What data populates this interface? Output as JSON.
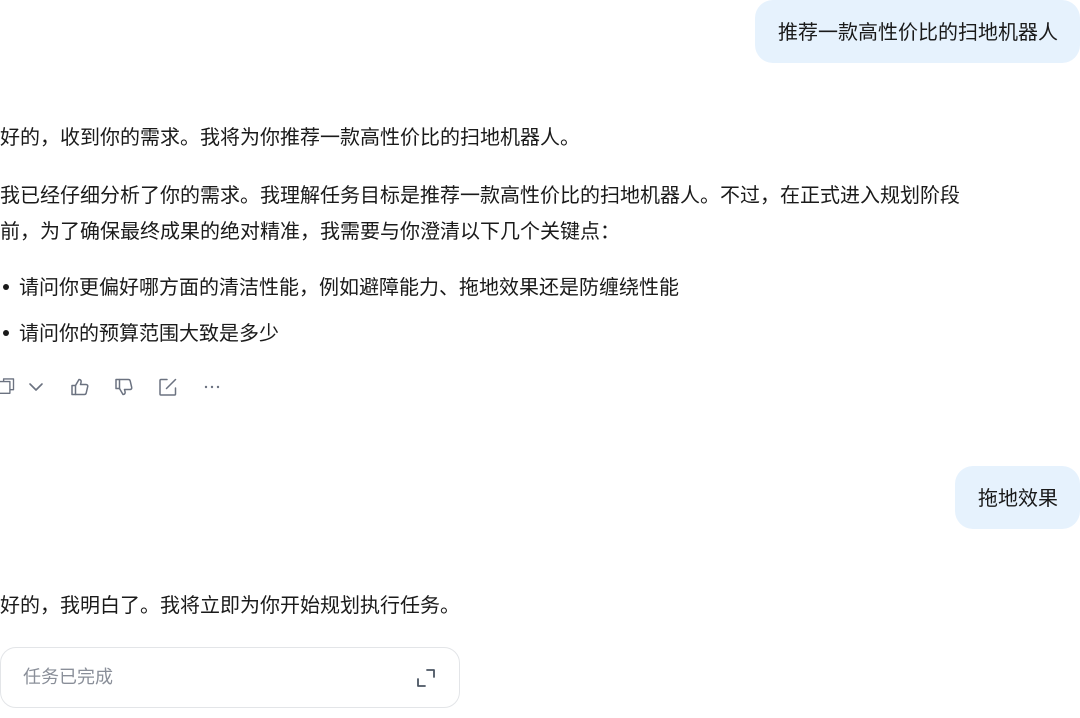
{
  "conversation": {
    "user_message_1": "推荐一款高性价比的扫地机器人",
    "assistant_message_1": {
      "ack": "好的，收到你的需求。我将为你推荐一款高性价比的扫地机器人。",
      "analysis_line_1": "我已经仔细分析了你的需求。我理解任务目标是推荐一款高性价比的扫地机器人。不过，在正式进入规划阶段",
      "analysis_line_2": "前，为了确保最终成果的绝对精准，我需要与你澄清以下几个关键点：",
      "questions": [
        "请问你更偏好哪方面的清洁性能，例如避障能力、拖地效果还是防缠绕性能",
        "请问你的预算范围大致是多少"
      ]
    },
    "message_actions": [
      "copy-icon",
      "chevron-down-icon",
      "thumbs-up-icon",
      "thumbs-down-icon",
      "edit-icon",
      "more-icon"
    ],
    "user_message_2": "拖地效果",
    "assistant_message_2": "好的，我明白了。我将立即为你开始规划执行任务。",
    "task_status": {
      "label": "任务已完成",
      "icon": "expand-icon"
    }
  },
  "colors": {
    "user_bubble_bg": "#e6f2fd",
    "text": "#1a1a1a",
    "muted_text": "#8a8f99",
    "icon": "#6b7280"
  }
}
